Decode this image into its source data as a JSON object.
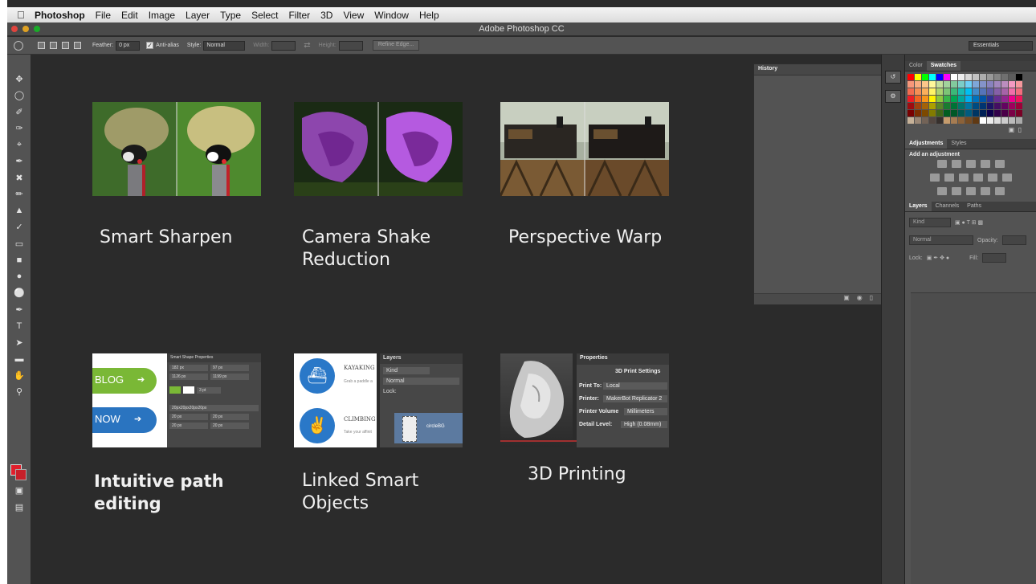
{
  "menubar": {
    "apple_icon": "apple-icon",
    "app_name": "Photoshop",
    "items": [
      "File",
      "Edit",
      "Image",
      "Layer",
      "Type",
      "Select",
      "Filter",
      "3D",
      "View",
      "Window",
      "Help"
    ]
  },
  "window": {
    "title": "Adobe Photoshop CC"
  },
  "options_bar": {
    "feather_label": "Feather:",
    "feather_value": "0 px",
    "antialias_label": "Anti-alias",
    "antialias_checked": true,
    "style_label": "Style:",
    "style_value": "Normal",
    "width_label": "Width:",
    "height_label": "Height:",
    "refine_edge_label": "Refine Edge...",
    "workspace_value": "Essentials"
  },
  "features": [
    {
      "caption": "Smart Sharpen",
      "bold": false
    },
    {
      "caption": "Camera Shake\nReduction",
      "bold": false
    },
    {
      "caption": "Perspective Warp",
      "bold": false
    },
    {
      "caption": "Intuitive path\nediting",
      "bold": true
    },
    {
      "caption": "Linked Smart\nObjects",
      "bold": false
    },
    {
      "caption": "3D Printing",
      "bold": false
    }
  ],
  "shape_props": {
    "title": "Smart Shape Properties",
    "blog": "BLOG",
    "now": "NOW",
    "w": "182 px",
    "h": "97 px",
    "x": "1126 px",
    "y": "1199 px",
    "stroke": "3 pt",
    "radius": "20px20px20px20px",
    "r1": "20 px",
    "r2": "20 px",
    "r3": "20 px",
    "r4": "20 px"
  },
  "linked_thumb": {
    "kayaking": "KAYAKING",
    "kayak_sub": "Grab a paddle a",
    "climbing": "CLIMBING",
    "climb_sub": "Take your affinit",
    "layers_tab": "Layers",
    "kind": "Kind",
    "mode": "Normal",
    "lock": "Lock:",
    "layer_name": "circleBG"
  },
  "print_thumb": {
    "tab": "Properties",
    "settings": "3D Print Settings",
    "print_to_label": "Print To:",
    "print_to": "Local",
    "printer_label": "Printer:",
    "printer": "MakerBot Replicator 2",
    "volume_label": "Printer Volume",
    "volume": "Millimeters",
    "detail_label": "Detail Level:",
    "detail": "High  (0.08mm)"
  },
  "history_panel": {
    "tab": "History"
  },
  "right_dock": {
    "color_tabs": [
      "Color",
      "Swatches"
    ],
    "adjust_tabs": [
      "Adjustments",
      "Styles"
    ],
    "add_adjustment": "Add an adjustment",
    "layer_tabs": [
      "Layers",
      "Channels",
      "Paths"
    ],
    "kind": "Kind",
    "blend": "Normal",
    "opacity_label": "Opacity:",
    "lock_label": "Lock:",
    "fill_label": "Fill:"
  },
  "colors": {
    "workspace_bg": "#2b2b2b",
    "panel_bg": "#535353",
    "foreground_swatch": "#e01f2c"
  }
}
